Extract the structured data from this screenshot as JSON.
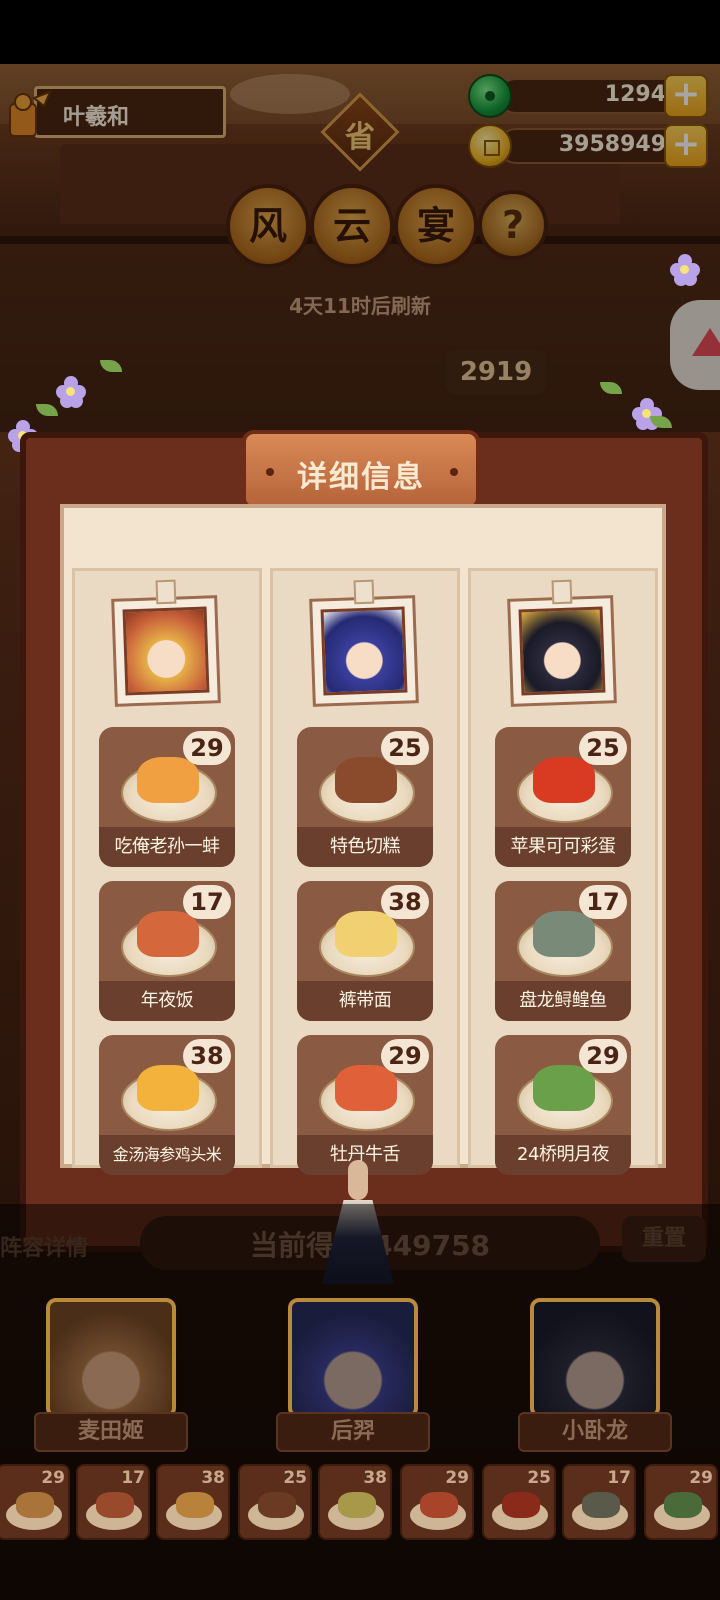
{
  "player": {
    "name": "叶羲和"
  },
  "currency": {
    "jade": "1294",
    "coins": "3958949"
  },
  "province_badge": "省",
  "event_title": [
    "风",
    "云",
    "宴"
  ],
  "help_symbol": "?",
  "refresh_text": "4天11时后刷新",
  "background_score": "2919",
  "panel": {
    "title": "详细信息"
  },
  "columns": [
    {
      "hero": "麦田姬",
      "dishes": [
        {
          "name": "吃俺老孙一蚌",
          "count": "29",
          "color": "#f0a040"
        },
        {
          "name": "年夜饭",
          "count": "17",
          "color": "#d4683c"
        },
        {
          "name": "金汤海参鸡头米",
          "count": "38",
          "color": "#f2b23c"
        }
      ]
    },
    {
      "hero": "后羿",
      "dishes": [
        {
          "name": "特色切糕",
          "count": "25",
          "color": "#8a4a2c"
        },
        {
          "name": "裤带面",
          "count": "38",
          "color": "#f0d070"
        },
        {
          "name": "牡丹牛舌",
          "count": "29",
          "color": "#e0603a"
        }
      ]
    },
    {
      "hero": "小卧龙",
      "dishes": [
        {
          "name": "苹果可可彩蛋",
          "count": "25",
          "color": "#d83a22"
        },
        {
          "name": "盘龙鲟鳇鱼",
          "count": "17",
          "color": "#7a8a78"
        },
        {
          "name": "24桥明月夜",
          "count": "29",
          "color": "#6aa04a"
        }
      ]
    }
  ],
  "bottom": {
    "lineup_detail": "阵容详情",
    "current_score_label": "当前得分:",
    "current_score": "449758",
    "reset": "重置",
    "heroes": [
      "麦田姬",
      "后羿",
      "小卧龙"
    ],
    "strip_counts": [
      "29",
      "17",
      "38",
      "25",
      "38",
      "29",
      "25",
      "17",
      "29"
    ]
  }
}
